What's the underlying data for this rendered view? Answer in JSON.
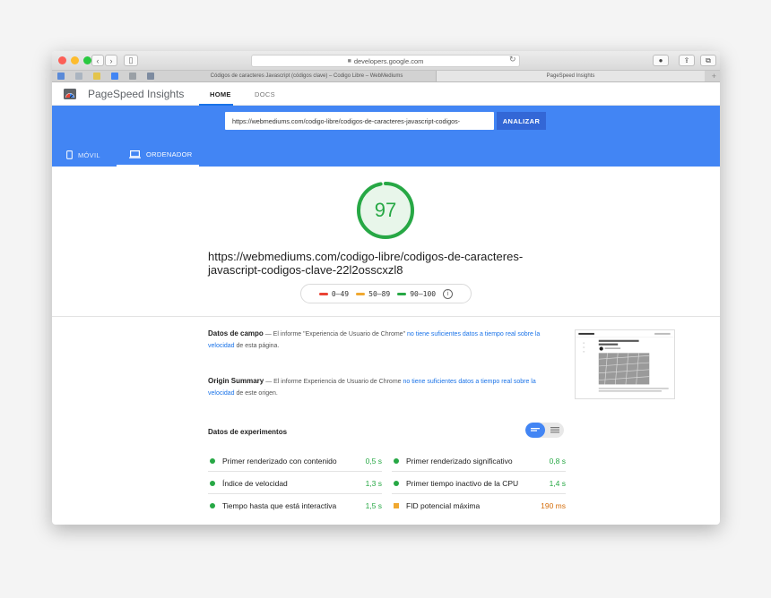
{
  "browser": {
    "address": "developers.google.com",
    "tabs": [
      {
        "label": "Códigos de caracteres Javascript (códigos clave) – Codigo Libre – WebMediums"
      },
      {
        "label": "PageSpeed Insights"
      }
    ],
    "new_tab": "+"
  },
  "header": {
    "app_title": "PageSpeed Insights",
    "nav": [
      {
        "label": "HOME"
      },
      {
        "label": "DOCS"
      }
    ]
  },
  "analyze": {
    "url_value": "https://webmediums.com/codigo-libre/codigos-de-caracteres-javascript-codigos-",
    "button_label": "ANALIZAR"
  },
  "device_tabs": [
    {
      "label": "MÓVIL"
    },
    {
      "label": "ORDENADOR"
    }
  ],
  "score": {
    "value": "97",
    "color": "#27a845",
    "fraction": 0.97,
    "page_url_line1": "https://webmediums.com/codigo-libre/codigos-de-caracteres-",
    "page_url_line2": "javascript-codigos-clave-22l2osscxzl8"
  },
  "legend": [
    {
      "range": "0–49",
      "color": "#ea4335"
    },
    {
      "range": "50–89",
      "color": "#f0a830"
    },
    {
      "range": "90–100",
      "color": "#27a845"
    }
  ],
  "field_data": {
    "title": "Datos de campo",
    "text1": " — El informe \"Experiencia de Usuario de Chrome\" ",
    "link": "no tiene suficientes datos a tiempo real sobre la velocidad",
    "text2": " de esta página."
  },
  "origin_summary": {
    "title": "Origin Summary",
    "text1": " — El informe Experiencia de Usuario de Chrome ",
    "link": "no tiene suficientes datos a tiempo real sobre la velocidad",
    "text2": " de este origen."
  },
  "lab": {
    "title": "Datos de experimentos",
    "metrics": [
      {
        "label": "Primer renderizado con contenido",
        "value": "0,5 s",
        "status": "good"
      },
      {
        "label": "Primer renderizado significativo",
        "value": "0,8 s",
        "status": "good"
      },
      {
        "label": "Índice de velocidad",
        "value": "1,3 s",
        "status": "good"
      },
      {
        "label": "Primer tiempo inactivo de la CPU",
        "value": "1,4 s",
        "status": "good"
      },
      {
        "label": "Tiempo hasta que está interactiva",
        "value": "1,5 s",
        "status": "good"
      },
      {
        "label": "FID potencial máxima",
        "value": "190 ms",
        "status": "average"
      }
    ]
  },
  "colors": {
    "brand_blue": "#4285f4",
    "good": "#27a845",
    "average": "#f0a830",
    "poor": "#ea4335",
    "link": "#1a73e8"
  }
}
